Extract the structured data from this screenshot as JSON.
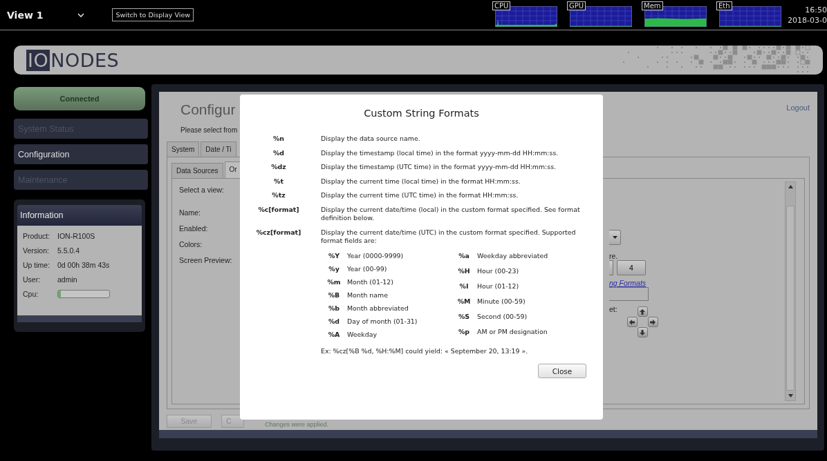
{
  "top_bar": {
    "view_selector": "View 1",
    "switch_button": "Switch to Display View",
    "monitors": [
      {
        "label": "CPU",
        "kind": "spike"
      },
      {
        "label": "GPU",
        "kind": "idle"
      },
      {
        "label": "Mem",
        "kind": "filled"
      },
      {
        "label": "Eth",
        "kind": "idle"
      }
    ],
    "time": "16:50",
    "date": "2018-03-0"
  },
  "logo": {
    "boxed": "IO",
    "text": "NODES"
  },
  "sidebar": {
    "status_button": "Connected",
    "nav": [
      {
        "label": "System Status",
        "disabled": true
      },
      {
        "label": "Configuration",
        "disabled": false
      },
      {
        "label": "Maintenance",
        "disabled": true
      }
    ],
    "info": {
      "title": "Information",
      "rows": [
        {
          "label": "Product:",
          "value": "ION-R100S"
        },
        {
          "label": "Version:",
          "value": "5.5.0.4"
        },
        {
          "label": "Up time:",
          "value": "0d 00h 38m 43s"
        },
        {
          "label": "User:",
          "value": "admin"
        }
      ],
      "cpu": {
        "label": "Cpu:",
        "level": 0.05
      }
    }
  },
  "main": {
    "title": "Configur",
    "subtitle": "Please select from",
    "logout": "Logout",
    "tabs": [
      {
        "label": "System",
        "selected": false
      },
      {
        "label": "Date / Ti",
        "selected": false
      }
    ],
    "subtabs": [
      {
        "label": "Data Sources",
        "selected": false
      },
      {
        "label": "Or",
        "selected": true
      }
    ],
    "field_labels": [
      "Select a view:",
      "Name:",
      "Enabled:",
      "Colors:",
      "Screen Preview:"
    ],
    "right_fragments": {
      "note": "re.",
      "number_button": "4",
      "link": "ng Formats",
      "offset_label": "et:"
    },
    "save_button": "Save",
    "cancel_button": "C",
    "status_message": "Changes were applied."
  },
  "dialog": {
    "title": "Custom String Formats",
    "entries": [
      {
        "code": "%n",
        "description": "Display the data source name."
      },
      {
        "code": "%d",
        "description": "Display the timestamp (local time) in the format yyyy-mm-dd HH:mm:ss."
      },
      {
        "code": "%dz",
        "description": "Display the timestamp (UTC time) in the format yyyy-mm-dd HH:mm:ss."
      },
      {
        "code": "%t",
        "description": "Display the current time (local time) in the format HH:mm:ss."
      },
      {
        "code": "%tz",
        "description": "Display the current time (UTC time) in the format HH:mm:ss."
      },
      {
        "code": "%c[format]",
        "description": "Display the current date/time (local) in the custom format specified.  See format definition below."
      },
      {
        "code": "%cz[format]",
        "description": "Display the current date/time (UTC) in the custom format specified. Supported format fields are:"
      }
    ],
    "field_columns": [
      {
        "fields": [
          {
            "code": "%Y",
            "description": "Year (0000-9999)"
          },
          {
            "code": "%y",
            "description": "Year (00-99)"
          },
          {
            "code": "%m",
            "description": "Month (01-12)"
          },
          {
            "code": "%B",
            "description": "Month name"
          },
          {
            "code": "%b",
            "description": "Month abbreviated"
          },
          {
            "code": "%d",
            "description": "Day of month (01-31)"
          },
          {
            "code": "%A",
            "description": "Weekday"
          }
        ]
      },
      {
        "fields": [
          {
            "code": "%a",
            "description": "Weekday abbreviated"
          },
          {
            "code": "%H",
            "description": "Hour (00-23)"
          },
          {
            "code": "%I",
            "description": "Hour (01-12)"
          },
          {
            "code": "%M",
            "description": "Minute (00-59)"
          },
          {
            "code": "%S",
            "description": "Second (00-59)"
          },
          {
            "code": "%p",
            "description": "AM or PM designation"
          }
        ]
      }
    ],
    "example": "Ex: %cz[%B %d, %H:%M] could yield: « September 20, 13:19 ».",
    "close_button": "Close"
  }
}
